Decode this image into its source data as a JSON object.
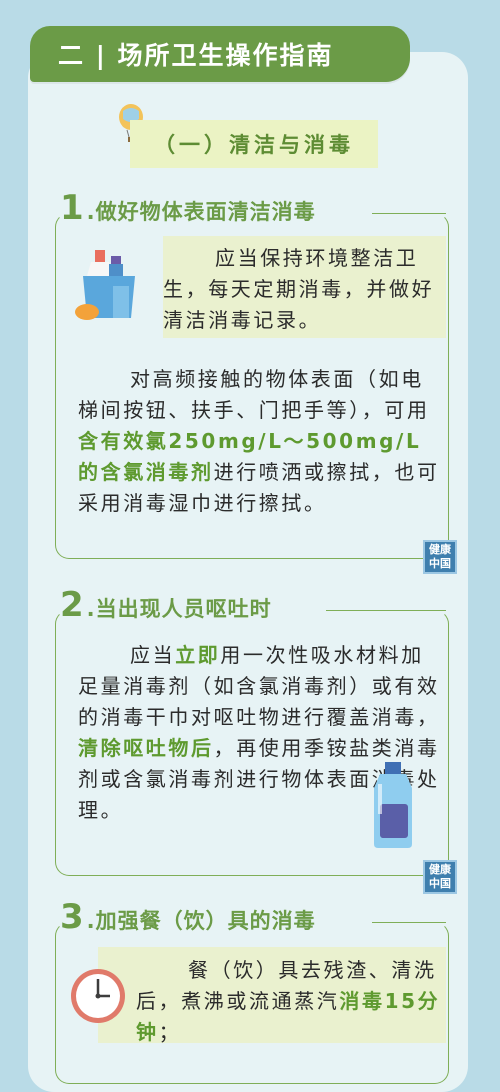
{
  "header": {
    "title": "二 | 场所卫生操作指南"
  },
  "subtitle": "（一）清洁与消毒",
  "sections": [
    {
      "num": "1",
      "title": ".做好物体表面清洁消毒",
      "p1": "应当保持环境整洁卫生，每天定期消毒，并做好清洁消毒记录。",
      "p2a": "对高频接触的物体表面（如电梯间按钮、扶手、门把手等），可用",
      "p2b": "含有效氯250mg/L～500mg/L的含氯消毒剂",
      "p2c": "进行喷洒或擦拭，也可采用消毒湿巾进行擦拭。"
    },
    {
      "num": "2",
      "title": ".当出现人员呕吐时",
      "p1a": "应当",
      "p1b": "立即",
      "p1c": "用一次性吸水材料加足量消毒剂（如含氯消毒剂）或有效的消毒干巾对呕吐物进行覆盖消毒，",
      "p1d": "清除呕吐物后",
      "p1e": "，再使用季铵盐类消毒剂或含氯消毒剂进行物体表面消毒处理。"
    },
    {
      "num": "3",
      "title": ".加强餐（饮）具的消毒",
      "p1a": "餐（饮）具去残渣、清洗后，煮沸或流通蒸汽",
      "p1b": "消毒15分钟",
      "p1c": "；"
    }
  ],
  "watermark": {
    "line1": "健康",
    "line2": "中国"
  },
  "icons": [
    "balloon-icon",
    "cleaning-supplies-icon",
    "detergent-bottle-icon",
    "clock-icon"
  ],
  "colors": {
    "accent": "#6b9b47",
    "highlight": "#5e9a2f",
    "background": "#b9dbe7",
    "panel": "#e7f3f5"
  }
}
